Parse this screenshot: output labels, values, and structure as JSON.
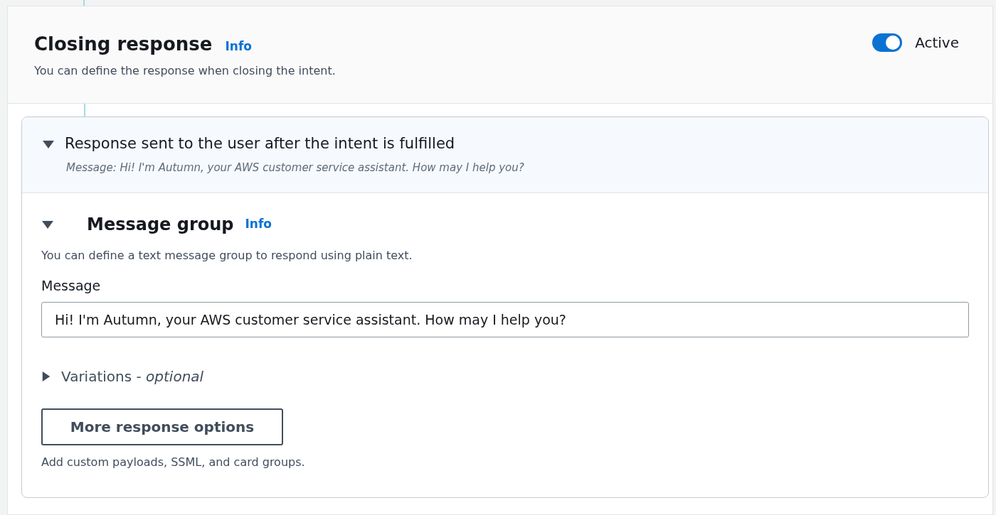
{
  "panel": {
    "title": "Closing response",
    "info_link": "Info",
    "description": "You can define the response when closing the intent.",
    "toggle": {
      "label": "Active",
      "on": true
    }
  },
  "response_section": {
    "title": "Response sent to the user after the intent is fulfilled",
    "summary": "Message: Hi! I'm Autumn, your AWS customer service assistant. How may I help you?",
    "expanded": true,
    "message_group": {
      "title": "Message group",
      "info_link": "Info",
      "expanded": true,
      "description": "You can define a text message group to respond using plain text.",
      "field_label": "Message",
      "field_value": "Hi! I'm Autumn, your AWS customer service assistant. How may I help you?",
      "variations": {
        "label": "Variations - *optional*",
        "expanded": false
      },
      "button": "More response options",
      "button_hint": "Add custom payloads, SSML, and card groups."
    }
  }
}
